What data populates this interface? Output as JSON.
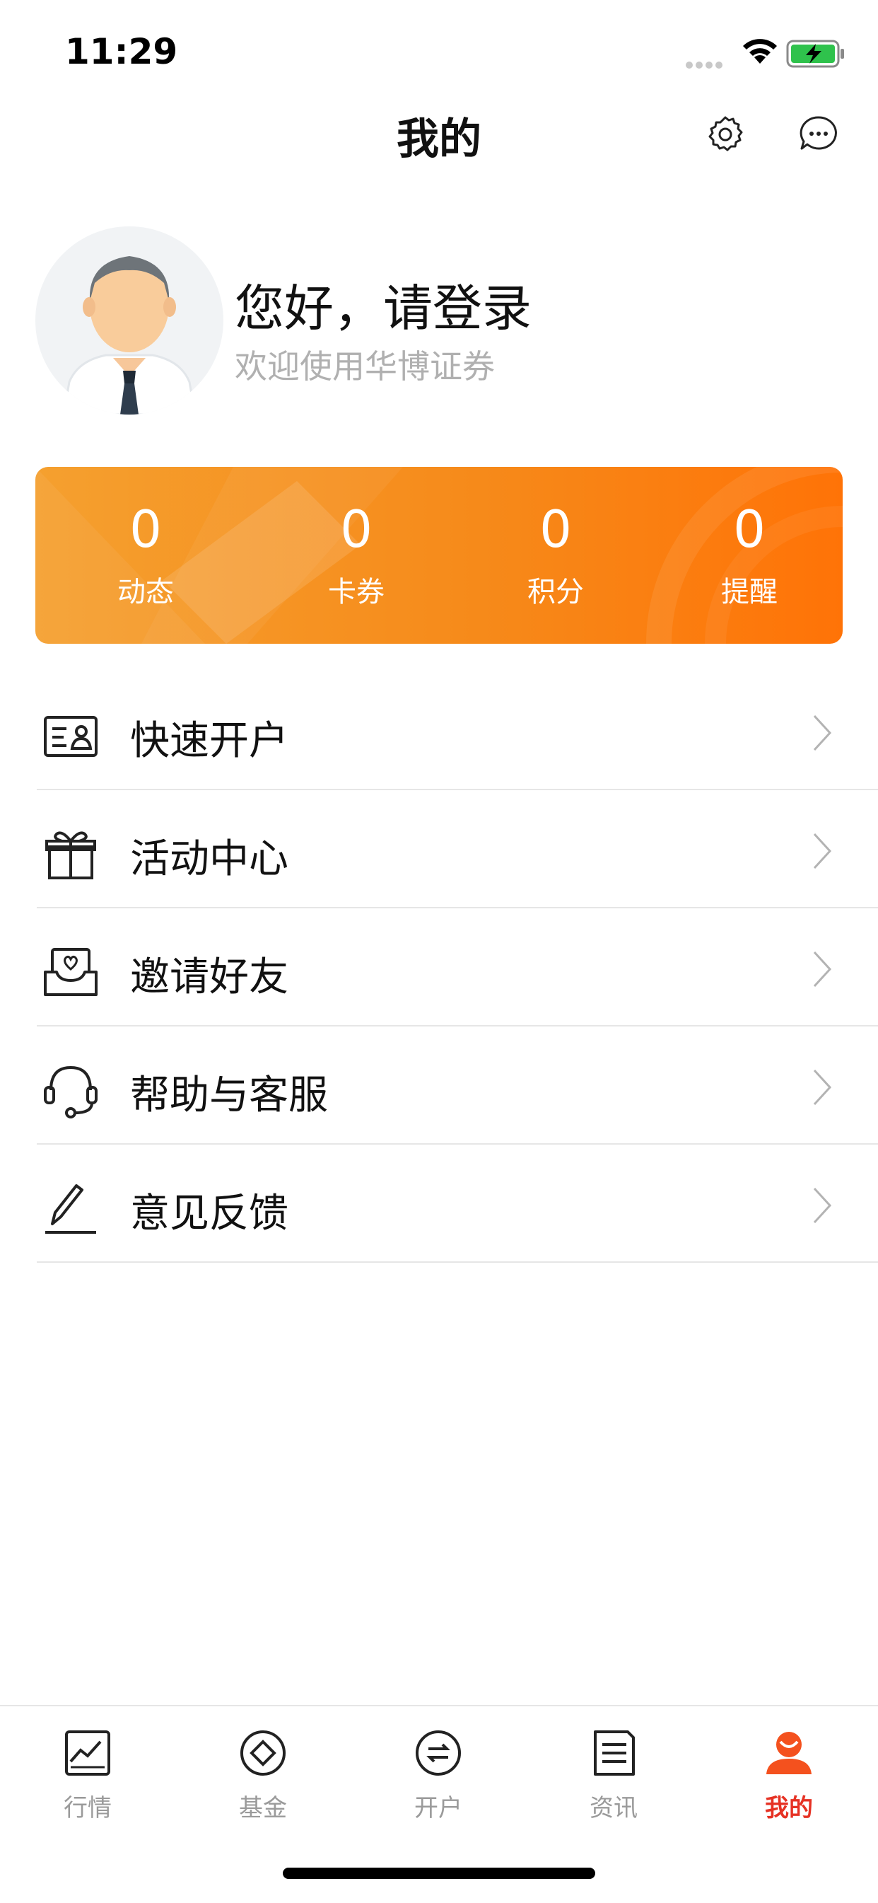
{
  "status_bar": {
    "time": "11:29"
  },
  "header": {
    "title": "我的",
    "settings_icon": "gear-icon",
    "message_icon": "chat-bubble-icon"
  },
  "profile": {
    "greeting": "您好，请登录",
    "subtitle": "欢迎使用华博证券"
  },
  "stats": [
    {
      "value": "0",
      "label": "动态"
    },
    {
      "value": "0",
      "label": "卡券"
    },
    {
      "value": "0",
      "label": "积分"
    },
    {
      "value": "0",
      "label": "提醒"
    }
  ],
  "menu": [
    {
      "label": "快速开户",
      "icon": "id-card-icon"
    },
    {
      "label": "活动中心",
      "icon": "gift-icon"
    },
    {
      "label": "邀请好友",
      "icon": "invite-envelope-icon"
    },
    {
      "label": "帮助与客服",
      "icon": "headset-icon"
    },
    {
      "label": "意见反馈",
      "icon": "pencil-icon"
    }
  ],
  "tabbar": [
    {
      "label": "行情",
      "icon": "chart-icon",
      "active": false
    },
    {
      "label": "基金",
      "icon": "fund-diamond-icon",
      "active": false
    },
    {
      "label": "开户",
      "icon": "open-account-icon",
      "active": false
    },
    {
      "label": "资讯",
      "icon": "news-icon",
      "active": false
    },
    {
      "label": "我的",
      "icon": "user-icon",
      "active": true
    }
  ],
  "colors": {
    "accent": "#e63224",
    "card_start": "#f5a02f",
    "card_end": "#ff7307"
  }
}
